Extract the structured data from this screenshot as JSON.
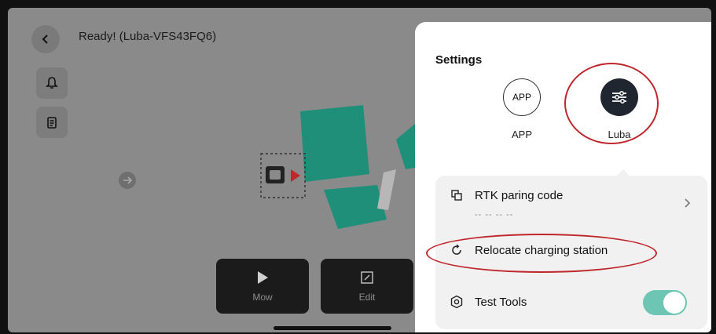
{
  "header": {
    "title": "Ready! (Luba-VFS43FQ6)"
  },
  "dock": {
    "mow_label": "Mow",
    "edit_label": "Edit"
  },
  "settings": {
    "title": "Settings",
    "devices": [
      {
        "icon_text": "APP",
        "label": "APP"
      },
      {
        "label": "Luba"
      }
    ],
    "items": [
      {
        "label": "RTK paring code",
        "value": "-- -- -- --"
      },
      {
        "label": "Relocate charging station"
      },
      {
        "label": "Test Tools",
        "toggle": true
      }
    ]
  },
  "colors": {
    "highlight_ring": "#c0272d",
    "map_zone": "#1f8f7a",
    "toggle_on": "#6cc6b3",
    "luba_icon_bg": "#1f2630"
  }
}
